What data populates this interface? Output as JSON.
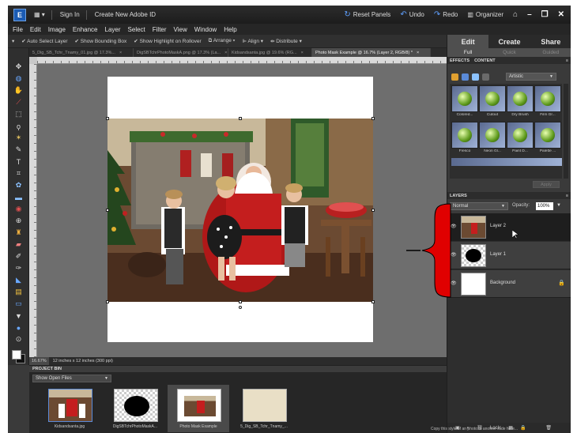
{
  "titlebar": {
    "sign_in": "Sign In",
    "create_id": "Create New Adobe ID",
    "reset_panels": "Reset Panels",
    "undo": "Undo",
    "redo": "Redo",
    "organizer": "Organizer"
  },
  "menu": [
    "File",
    "Edit",
    "Image",
    "Enhance",
    "Layer",
    "Select",
    "Filter",
    "View",
    "Window",
    "Help"
  ],
  "options": {
    "auto_select": "Auto Select Layer",
    "bounding_box": "Show Bounding Box",
    "highlight": "Show Highlight on Rollover",
    "arrange": "Arrange",
    "align": "Align",
    "distribute": "Distribute"
  },
  "doc_tabs": [
    "5_Dig_SB_Tchr_Tnamy_01.jpg @ 17.3%...",
    "DigSBTchrPhotoMaskA.png @ 17.3% (La...",
    "Kidsandsanta.jpg @ 19.6% (RG...",
    "Photo Mask Example @ 16.7% (Layer 2, RGB/8) *"
  ],
  "status": {
    "zoom": "16.67%",
    "info": "12 inches x 12 inches (300 ppi)"
  },
  "project_bin": {
    "header": "PROJECT BIN",
    "filter": "Show Open Files",
    "items": [
      "Kidsandsanta.jpg",
      "DigSBTchrPhotoMaskA...",
      "Photo Mask Example",
      "5_Dig_SB_Tchr_Tnamy_..."
    ]
  },
  "panel": {
    "mode_tabs": [
      "Edit",
      "Create",
      "Share"
    ],
    "sub_tabs": [
      "Full",
      "Quick",
      "Guided"
    ],
    "effects_header": "EFFECTS",
    "content_header": "CONTENT",
    "effects_category": "Artistic",
    "effects": [
      "Colored...",
      "Cutout",
      "Dry Brush",
      "Film Gr...",
      "Fresco",
      "Neon Gl...",
      "Paint D...",
      "Palette ..."
    ],
    "apply": "Apply",
    "layers_header": "LAYERS",
    "blend_mode": "Normal",
    "opacity_label": "Opacity:",
    "opacity_value": "100%",
    "layers": [
      "Layer 2",
      "Layer 1",
      "Background"
    ],
    "lock_label": "Lock:"
  },
  "colors": {
    "annotation": "#e00000",
    "selected_layer": "#1e1e1e"
  },
  "caption": "Copy this style of an photo to another slide here..."
}
